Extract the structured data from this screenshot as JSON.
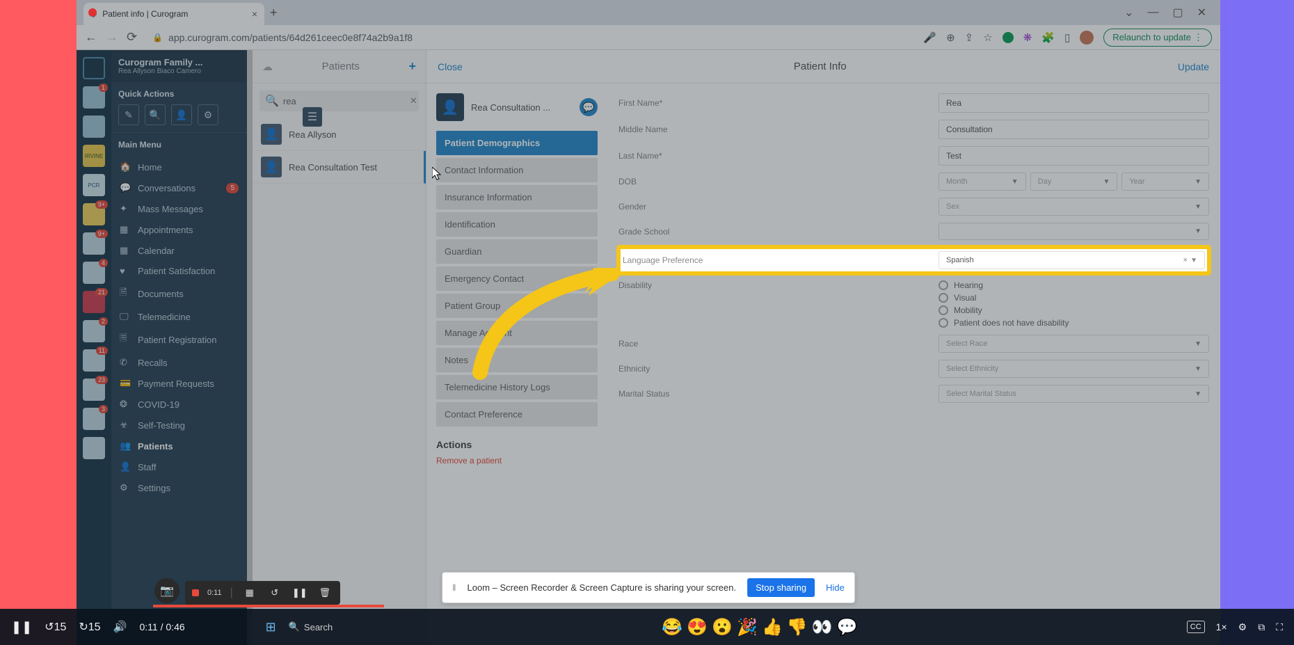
{
  "browser": {
    "tab_title": "Patient info | Curogram",
    "url": "app.curogram.com/patients/64d261ceec0e8f74a2b9a1f8",
    "relaunch": "Relaunch to update"
  },
  "clinic": {
    "name": "Curogram Family ...",
    "user": "Rea Allyson Biaco Camero"
  },
  "quick_actions_label": "Quick Actions",
  "main_menu_label": "Main Menu",
  "menu": [
    {
      "label": "Home",
      "icon": "🏠"
    },
    {
      "label": "Conversations",
      "icon": "💬",
      "badge": "5"
    },
    {
      "label": "Mass Messages",
      "icon": "✦"
    },
    {
      "label": "Appointments",
      "icon": "▦"
    },
    {
      "label": "Calendar",
      "icon": "▦"
    },
    {
      "label": "Patient Satisfaction",
      "icon": "♥"
    },
    {
      "label": "Documents",
      "icon": "🗎"
    },
    {
      "label": "Telemedicine",
      "icon": "🖵"
    },
    {
      "label": "Patient Registration",
      "icon": "🗏"
    },
    {
      "label": "Recalls",
      "icon": "✆"
    },
    {
      "label": "Payment Requests",
      "icon": "💳"
    },
    {
      "label": "COVID-19",
      "icon": "❂"
    },
    {
      "label": "Self-Testing",
      "icon": "☣"
    },
    {
      "label": "Patients",
      "icon": "👥",
      "bold": true
    },
    {
      "label": "Staff",
      "icon": "👤"
    },
    {
      "label": "Settings",
      "icon": "⚙"
    }
  ],
  "rail_badges": [
    "1",
    "",
    "",
    "",
    "9+",
    "9+",
    "4",
    "21",
    "2",
    "11",
    "23",
    "3"
  ],
  "patients": {
    "title": "Patients",
    "search": "rea",
    "results": [
      {
        "name": "Rea Allyson"
      },
      {
        "name": "Rea Consultation Test",
        "selected": true
      }
    ]
  },
  "detail": {
    "close": "Close",
    "title": "Patient Info",
    "update": "Update",
    "patient_name": "Rea Consultation ...",
    "sections": [
      {
        "label": "Patient Demographics",
        "active": true
      },
      {
        "label": "Contact Information"
      },
      {
        "label": "Insurance Information"
      },
      {
        "label": "Identification"
      },
      {
        "label": "Guardian"
      },
      {
        "label": "Emergency Contact"
      },
      {
        "label": "Patient Group"
      },
      {
        "label": "Manage Account"
      },
      {
        "label": "Notes"
      },
      {
        "label": "Telemedicine History Logs"
      },
      {
        "label": "Contact Preference"
      }
    ],
    "actions_title": "Actions",
    "remove": "Remove a patient"
  },
  "form": {
    "first_name": {
      "label": "First Name*",
      "value": "Rea"
    },
    "middle_name": {
      "label": "Middle Name",
      "value": "Consultation"
    },
    "last_name": {
      "label": "Last Name*",
      "value": "Test"
    },
    "dob": {
      "label": "DOB",
      "month": "Month",
      "day": "Day",
      "year": "Year"
    },
    "gender": {
      "label": "Gender",
      "value": "Sex"
    },
    "grade": {
      "label": "Grade School",
      "value": ""
    },
    "language": {
      "label": "Language Preference",
      "value": "Spanish"
    },
    "disability": {
      "label": "Disability",
      "options": [
        "Hearing",
        "Visual",
        "Mobility",
        "Patient does not have disability"
      ]
    },
    "race": {
      "label": "Race",
      "value": "Select Race"
    },
    "ethnicity": {
      "label": "Ethnicity",
      "value": "Select Ethnicity"
    },
    "marital": {
      "label": "Marital Status",
      "value": "Select Marital Status"
    }
  },
  "share": {
    "text": "Loom – Screen Recorder & Screen Capture is sharing your screen.",
    "stop": "Stop sharing",
    "hide": "Hide"
  },
  "loom": {
    "time": "0:11"
  },
  "player": {
    "current": "0:11",
    "total": "0:46",
    "speed": "1×",
    "search": "Search"
  }
}
